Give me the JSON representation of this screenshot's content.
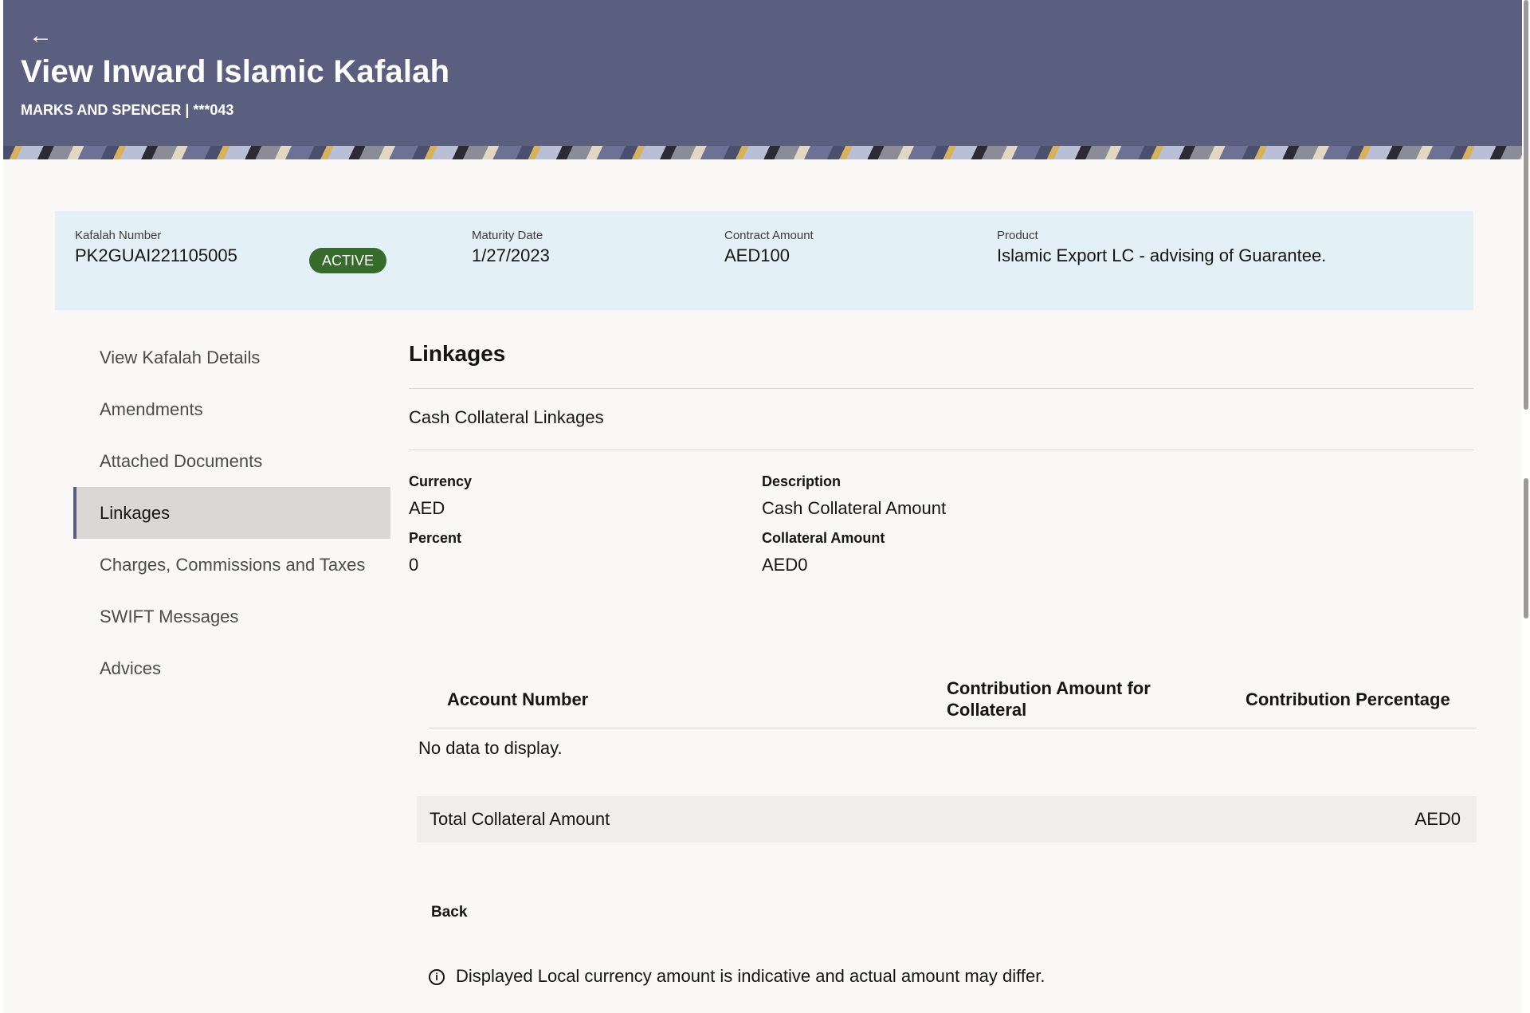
{
  "header": {
    "title": "View Inward Islamic Kafalah",
    "subtitle": "MARKS AND SPENCER | ***043",
    "back_icon": "arrow-left-icon",
    "background_color": "#5a5f80"
  },
  "summary": {
    "kafalah_number_label": "Kafalah Number",
    "kafalah_number": "PK2GUAI221105005",
    "status": "ACTIVE",
    "status_color": "#366b2b",
    "maturity_date_label": "Maturity Date",
    "maturity_date": "1/27/2023",
    "contract_amount_label": "Contract Amount",
    "contract_amount": "AED100",
    "product_label": "Product",
    "product": "Islamic Export LC - advising of Guarantee."
  },
  "nav": {
    "items": [
      {
        "label": "View Kafalah Details",
        "active": false
      },
      {
        "label": "Amendments",
        "active": false
      },
      {
        "label": "Attached Documents",
        "active": false
      },
      {
        "label": "Linkages",
        "active": true
      },
      {
        "label": "Charges, Commissions and Taxes",
        "active": false
      },
      {
        "label": "SWIFT Messages",
        "active": false
      },
      {
        "label": "Advices",
        "active": false
      }
    ]
  },
  "main": {
    "section_title": "Linkages",
    "collateral_title": "Cash Collateral Linkages",
    "fields": {
      "currency_label": "Currency",
      "currency": "AED",
      "description_label": "Description",
      "description": "Cash Collateral Amount",
      "percent_label": "Percent",
      "percent": "0",
      "collateral_amount_label": "Collateral Amount",
      "collateral_amount": "AED0"
    },
    "table": {
      "columns": [
        "Account Number",
        "Contribution Amount for Collateral",
        "Contribution Percentage"
      ],
      "empty_text": "No data to display."
    },
    "total_label": "Total Collateral Amount",
    "total_value": "AED0",
    "back_label": "Back",
    "disclaimer": "Displayed Local currency amount is indicative and actual amount may differ.",
    "info_icon": "info-icon"
  }
}
